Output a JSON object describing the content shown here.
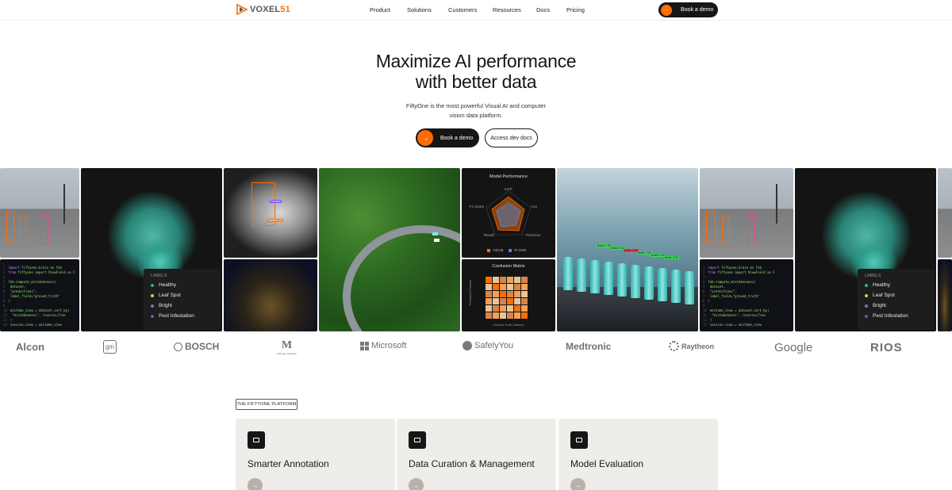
{
  "header": {
    "logo_text": "VOXEL",
    "logo_num": "51",
    "nav": [
      "Product",
      "Solutions",
      "Customers",
      "Resources",
      "Docs",
      "Pricing"
    ],
    "cta": "Book a demo"
  },
  "hero": {
    "title_line1": "Maximize AI performance",
    "title_line2": "with better data",
    "subtitle_line1": "FiftyOne is the most powerful Visual AI and computer",
    "subtitle_line2": "vision data platform.",
    "primary_cta": "Book a demo",
    "secondary_cta": "Access dev docs"
  },
  "gallery": {
    "labels_panel": {
      "heading": "LABELS",
      "items": [
        {
          "name": "Healthy",
          "color": "#3fb26b"
        },
        {
          "name": "Leaf Spot",
          "color": "#9be07a"
        },
        {
          "name": "Bright",
          "color": "#5a7bd8"
        },
        {
          "name": "Pest Infestation",
          "color": "#5a63a6"
        }
      ]
    },
    "model_performance": {
      "title": "Model Performance",
      "axes": [
        "mAP",
        "IoU",
        "Precision",
        "Recall",
        "F1 Score"
      ],
      "legend": [
        {
          "name": "Yolov8",
          "color": "#ff6d04"
        },
        {
          "name": "R-CNN",
          "color": "#4b8be0"
        }
      ]
    },
    "confusion_matrix": {
      "title": "Confusion Matrix",
      "xlabel": "Ground Truth Classes",
      "ylabel": "Predicted Classes"
    },
    "xray_labels": [
      "Fracture",
      "Fracture (dt)"
    ],
    "bottle_labels": [
      "Bottle 0.95",
      "Bottle 0.92",
      "Bottle 0.95",
      "Bottle 0.91",
      "Bottle 0.93",
      "Bottle 0.96"
    ],
    "code_lines": [
      [
        "import",
        " fiftyone.brain as fob"
      ],
      [
        "from",
        " fiftyone import ViewField as F"
      ],
      [
        "",
        ""
      ],
      [
        "",
        "fob.compute_mistakenness("
      ],
      [
        "",
        "    dataset,"
      ],
      [
        "",
        "    \"predictions\","
      ],
      [
        "",
        "    label_field=\"ground_truth\""
      ],
      [
        "",
        ")"
      ],
      [
        "",
        ""
      ],
      [
        "",
        "mistake_view = dataset.sort_by("
      ],
      [
        "",
        "    \"mistakenness\", reverse=True"
      ],
      [
        "",
        ")"
      ],
      [
        "",
        "session.view = mistake_view"
      ]
    ]
  },
  "brands": [
    "Alcon",
    "gm",
    "BOSCH",
    "Michigan Medicine",
    "Microsoft",
    "SafelyYou",
    "Medtronic",
    "Raytheon",
    "Google",
    "RIOS"
  ],
  "platform": {
    "tag": "THE FIFTYONE PLATFORM",
    "cards": [
      "Smarter Annotation",
      "Data Curation & Management",
      "Model Evaluation"
    ]
  },
  "colors": {
    "accent": "#ff6d04",
    "dark": "#161616",
    "card_bg": "#efedea"
  }
}
